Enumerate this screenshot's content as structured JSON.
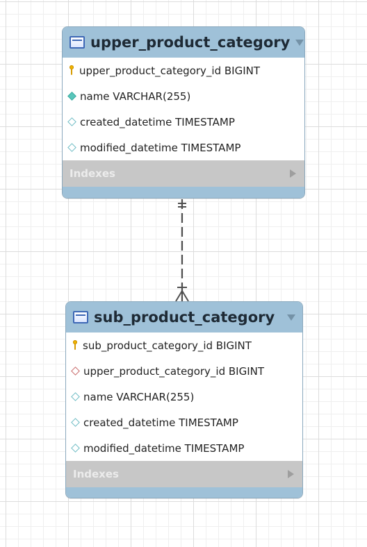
{
  "diagram": {
    "tables": [
      {
        "name": "upper_product_category",
        "columns": [
          {
            "icon": "primary-key-icon",
            "text": "upper_product_category_id BIGINT"
          },
          {
            "icon": "filled-diamond-icon",
            "text": "name VARCHAR(255)"
          },
          {
            "icon": "outline-diamond-icon",
            "text": "created_datetime TIMESTAMP"
          },
          {
            "icon": "outline-diamond-icon",
            "text": "modified_datetime TIMESTAMP"
          }
        ],
        "indexes_label": "Indexes"
      },
      {
        "name": "sub_product_category",
        "columns": [
          {
            "icon": "primary-key-icon",
            "text": "sub_product_category_id BIGINT"
          },
          {
            "icon": "foreign-key-diamond-icon",
            "text": "upper_product_category_id BIGINT"
          },
          {
            "icon": "outline-diamond-icon",
            "text": "name VARCHAR(255)"
          },
          {
            "icon": "outline-diamond-icon",
            "text": "created_datetime TIMESTAMP"
          },
          {
            "icon": "outline-diamond-icon",
            "text": "modified_datetime TIMESTAMP"
          }
        ],
        "indexes_label": "Indexes"
      }
    ],
    "relationship": {
      "line_style": "dashed"
    }
  },
  "colors": {
    "header": "#9fc1d8",
    "border": "#8aa8bd",
    "indexes_bar": "#c7c7c7",
    "indexes_text": "#ececec",
    "text": "#222222",
    "key": "#f0b400",
    "filled_diamond": "#59c6bb",
    "outline_diamond": "#6fbcc5",
    "foreign_diamond": "#c86a6a",
    "connector": "#4f4f4f"
  }
}
